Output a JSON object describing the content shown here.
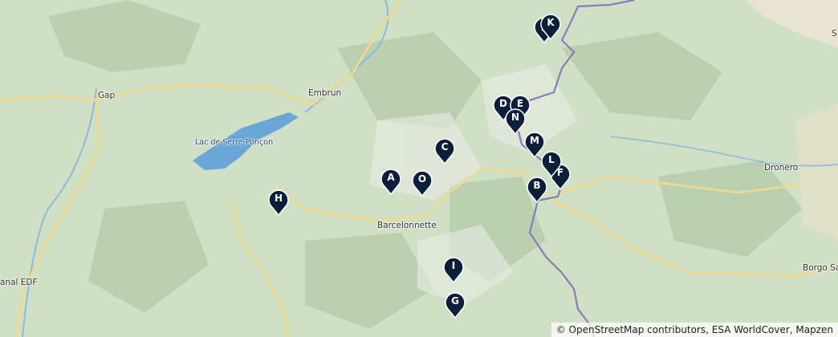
{
  "map": {
    "places": [
      {
        "id": "gap",
        "label": "Gap"
      },
      {
        "id": "embrun",
        "label": "Embrun"
      },
      {
        "id": "lac",
        "label": "Lac de Serre-Ponçon"
      },
      {
        "id": "barcelonnette",
        "label": "Barcelonnette"
      },
      {
        "id": "dronero",
        "label": "Dronero"
      },
      {
        "id": "borgo",
        "label": "Borgo Sa"
      },
      {
        "id": "s-edge",
        "label": "S"
      },
      {
        "id": "edf",
        "label": "anal EDF"
      }
    ],
    "markers": [
      "A",
      "B",
      "C",
      "D",
      "E",
      "F",
      "G",
      "H",
      "I",
      "K",
      "L",
      "M",
      "N",
      "O",
      "J"
    ],
    "attribution": "© OpenStreetMap contributors, ESA WorldCover, Mapzen",
    "colors": {
      "marker": "#0c1f3a",
      "border": "#8b7bb8",
      "road": "#f3d98a",
      "water": "#6aa6d8",
      "terrain": "#cfe0c4"
    }
  }
}
